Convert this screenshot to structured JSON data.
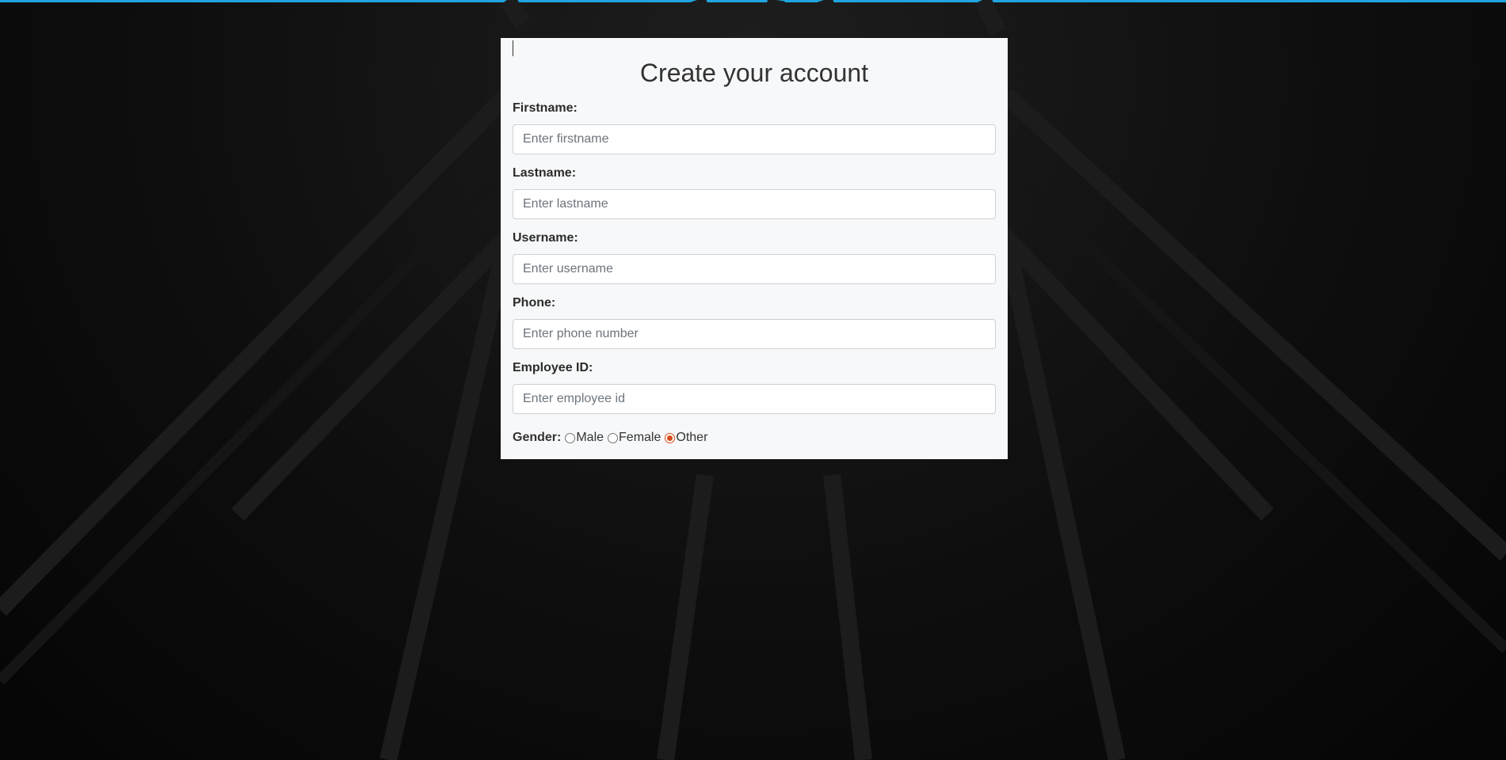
{
  "page": {
    "accent_color": "#1fa4e0",
    "background_color": "#0a0a0a"
  },
  "form": {
    "title": "Create your account",
    "fields": [
      {
        "label": "Firstname:",
        "placeholder": "Enter firstname",
        "value": ""
      },
      {
        "label": "Lastname:",
        "placeholder": "Enter lastname",
        "value": ""
      },
      {
        "label": "Username:",
        "placeholder": "Enter username",
        "value": ""
      },
      {
        "label": "Phone:",
        "placeholder": "Enter phone number",
        "value": ""
      },
      {
        "label": "Employee ID:",
        "placeholder": "Enter employee id",
        "value": ""
      }
    ],
    "gender": {
      "label": "Gender:",
      "options": [
        "Male",
        "Female",
        "Other"
      ],
      "selected": "Other",
      "selected_color": "#d94b1a"
    }
  }
}
